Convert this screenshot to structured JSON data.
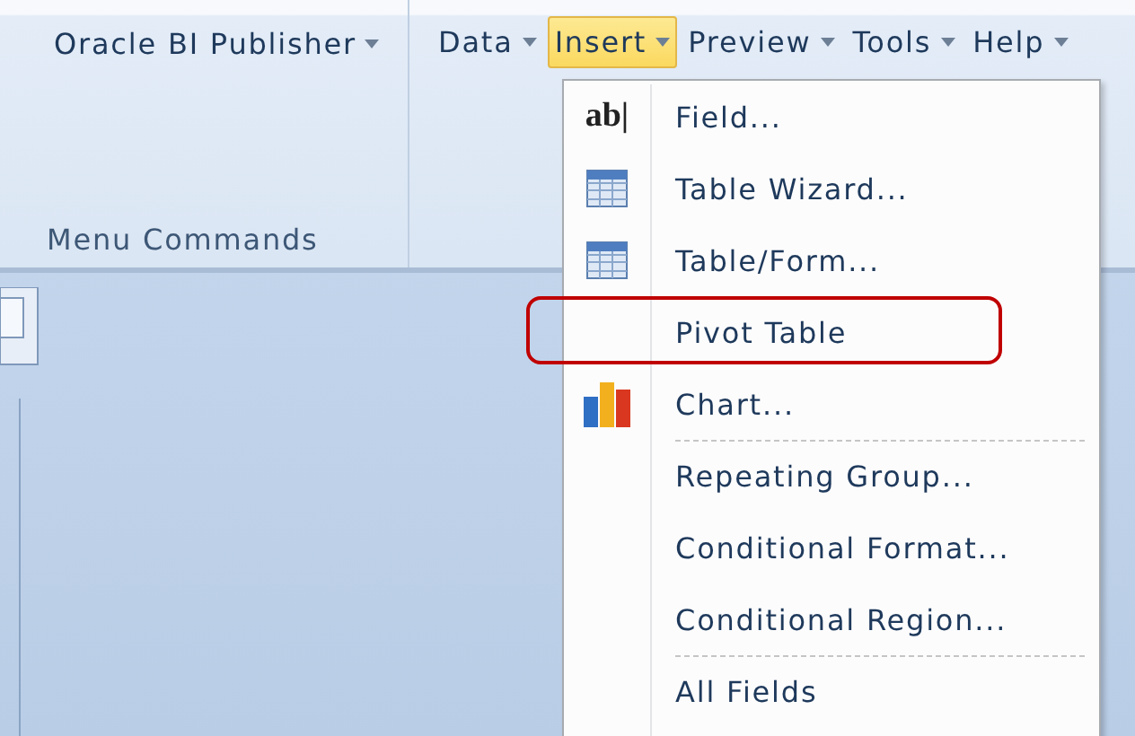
{
  "ribbon": {
    "menus": [
      {
        "label": "Oracle BI Publisher",
        "selected": false
      },
      {
        "label": "Data",
        "selected": false
      },
      {
        "label": "Insert",
        "selected": true
      },
      {
        "label": "Preview",
        "selected": false
      },
      {
        "label": "Tools",
        "selected": false
      },
      {
        "label": "Help",
        "selected": false
      }
    ],
    "group_label": "Menu Commands"
  },
  "dropdown": {
    "items": [
      {
        "label": "Field...",
        "kind": "text",
        "icon_label": "ab|",
        "separator_before": false,
        "highlighted": false
      },
      {
        "label": "Table Wizard...",
        "kind": "table",
        "separator_before": false,
        "highlighted": false
      },
      {
        "label": "Table/Form...",
        "kind": "table",
        "separator_before": false,
        "highlighted": false
      },
      {
        "label": "Pivot Table",
        "kind": "plain",
        "separator_before": false,
        "highlighted": true
      },
      {
        "label": "Chart...",
        "kind": "chart",
        "separator_before": false,
        "highlighted": false
      },
      {
        "label": "Repeating Group...",
        "kind": "plain",
        "separator_before": true,
        "highlighted": false
      },
      {
        "label": "Conditional Format...",
        "kind": "plain",
        "separator_before": false,
        "highlighted": false
      },
      {
        "label": "Conditional Region...",
        "kind": "plain",
        "separator_before": false,
        "highlighted": false
      },
      {
        "label": "All Fields",
        "kind": "plain",
        "separator_before": true,
        "highlighted": false
      }
    ]
  }
}
